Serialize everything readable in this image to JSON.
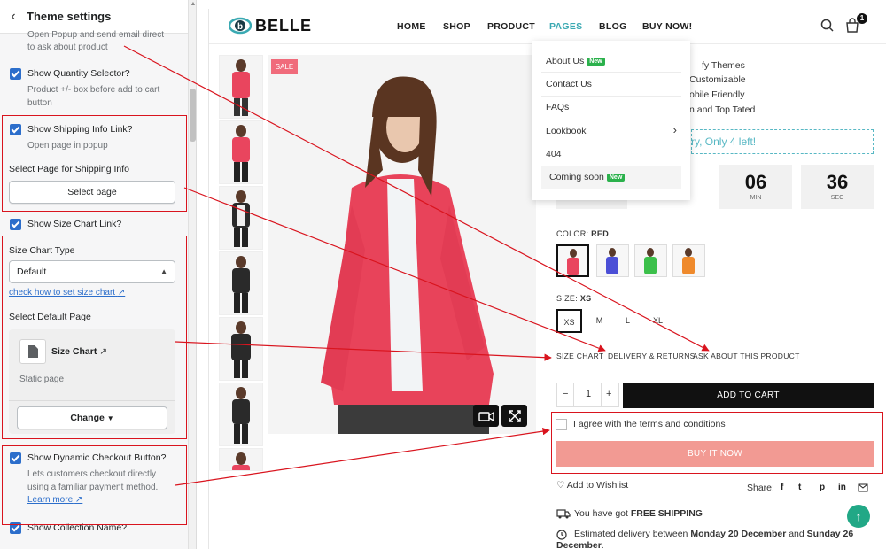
{
  "panel": {
    "title": "Theme settings",
    "truncated_help_line1": "Open Popup and send email direct",
    "truncated_help_line2": "to ask about product",
    "qty_selector": {
      "label": "Show Quantity Selector?",
      "help1": "Product +/- box before add to cart",
      "help2": "button"
    },
    "shipping": {
      "label": "Show Shipping Info Link?",
      "help": "Open page in popup",
      "page_label": "Select Page for Shipping Info",
      "button": "Select page"
    },
    "size_chart_link": {
      "label": "Show Size Chart Link?"
    },
    "size_chart": {
      "type_label": "Size Chart Type",
      "type_value": "Default",
      "howto_link": "check how to set size chart",
      "default_page_label": "Select Default Page",
      "page_name": "Size Chart",
      "page_type": "Static page",
      "change_button": "Change"
    },
    "dynamic_checkout": {
      "label": "Show Dynamic Checkout Button?",
      "help1": "Lets customers checkout directly",
      "help2": "using a familiar payment method.",
      "learn_more": "Learn more"
    },
    "collection_name": {
      "label": "Show Collection Name?"
    }
  },
  "store": {
    "brand": "BELLE",
    "brand_mark_letter": "b",
    "nav": [
      "HOME",
      "SHOP",
      "PRODUCT",
      "PAGES",
      "BLOG",
      "BUY NOW!"
    ],
    "cart_count": "1",
    "sale_badge": "SALE",
    "dropdown": {
      "items": [
        {
          "label": "About Us",
          "badge": "New"
        },
        {
          "label": "Contact Us"
        },
        {
          "label": "FAQs"
        },
        {
          "label": "Lookbook",
          "arrow": "›"
        },
        {
          "label": "404"
        },
        {
          "label": "Coming soon",
          "badge": "New"
        }
      ]
    },
    "features": [
      "fy Themes",
      "Customizable",
      "obile Friendly",
      "n and Top Tated"
    ],
    "stock_text": "ry, Only 4 left!",
    "countdown": [
      {
        "value": "06",
        "label": "MIN"
      },
      {
        "value": "36",
        "label": "SEC"
      }
    ],
    "color_label": "COLOR:",
    "color_value": "RED",
    "size_label": "SIZE:",
    "size_value": "XS",
    "sizes": [
      "XS",
      "M",
      "L",
      "XL"
    ],
    "links": [
      "SIZE CHART",
      "DELIVERY & RETURNS",
      "ASK ABOUT THIS PRODUCT"
    ],
    "qty_value": "1",
    "qty_minus": "−",
    "qty_plus": "+",
    "add_to_cart": "ADD TO CART",
    "terms": "I agree with the terms and conditions",
    "buy_now": "BUY IT NOW",
    "wishlist": "Add to Wishlist",
    "share_label": "Share:",
    "share_icons": [
      "f",
      "t",
      "p",
      "in",
      "mail"
    ],
    "shipping_prefix": "You have got ",
    "shipping_bold": "FREE SHIPPING",
    "delivery_prefix": "Estimated delivery between ",
    "delivery_from": "Monday 20 December",
    "delivery_and": " and ",
    "delivery_to": "Sunday 26",
    "delivery_to_line2": "December",
    "delivery_suffix": "."
  },
  "colors": {
    "accent_red": "#d9141e",
    "teal": "#3aa9b2",
    "shopify_blue": "#2c6ecb",
    "buy_now": "#f29a93"
  }
}
